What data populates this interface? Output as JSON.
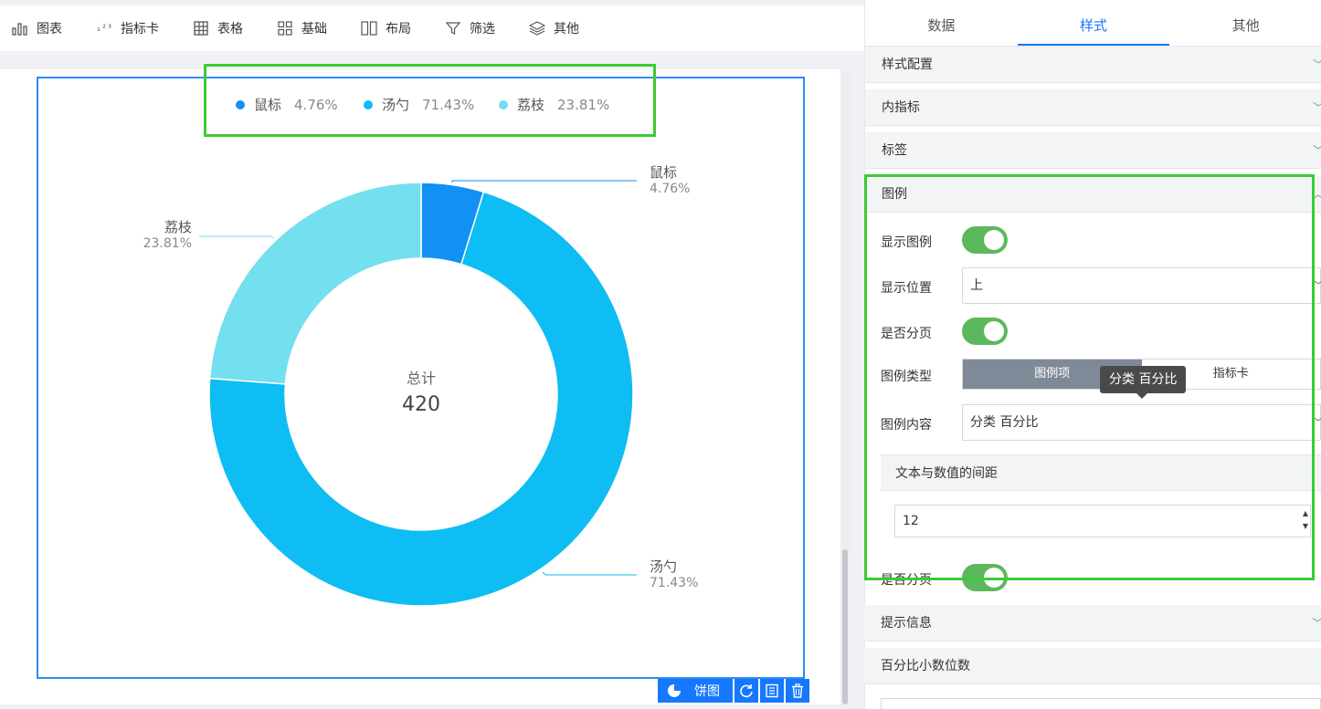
{
  "toolbar": {
    "items": [
      {
        "label": "图表",
        "icon": "bar-chart-icon"
      },
      {
        "label": "指标卡",
        "icon": "kpi-123-icon"
      },
      {
        "label": "表格",
        "icon": "table-icon"
      },
      {
        "label": "基础",
        "icon": "grid-blocks-icon"
      },
      {
        "label": "布局",
        "icon": "layout-columns-icon"
      },
      {
        "label": "筛选",
        "icon": "filter-icon"
      },
      {
        "label": "其他",
        "icon": "layers-icon"
      }
    ]
  },
  "chart_data": {
    "type": "pie",
    "variant": "donut",
    "categories": [
      "鼠标",
      "汤勺",
      "荔枝"
    ],
    "percent_labels": [
      "4.76%",
      "71.43%",
      "23.81%"
    ],
    "values": [
      20,
      300,
      100
    ],
    "colors": [
      "#1290f4",
      "#0ebdf3",
      "#74dfee"
    ],
    "legend_position": "top",
    "center_label": "总计",
    "center_value": "420"
  },
  "chart_footer": {
    "type_label": "饼图"
  },
  "panel": {
    "tabs": [
      "数据",
      "样式",
      "其他"
    ],
    "active_tab": "样式",
    "sections": {
      "style_config": "样式配置",
      "inner_indicator": "内指标",
      "label": "标签",
      "legend": "图例",
      "tooltip_info": "提示信息",
      "pct_decimals": "百分比小数位数"
    },
    "legend_settings": {
      "show_legend_label": "显示图例",
      "position_label": "显示位置",
      "position_value": "上",
      "paging_label": "是否分页",
      "legend_type_label": "图例类型",
      "legend_type_options": [
        "图例项",
        "指标卡"
      ],
      "legend_content_label": "图例内容",
      "legend_content_value": "分类 百分比",
      "tooltip_text": "分类 百分比",
      "spacing_title": "文本与数值的间距",
      "spacing_value": "12",
      "paging_label_2": "是否分页"
    }
  }
}
